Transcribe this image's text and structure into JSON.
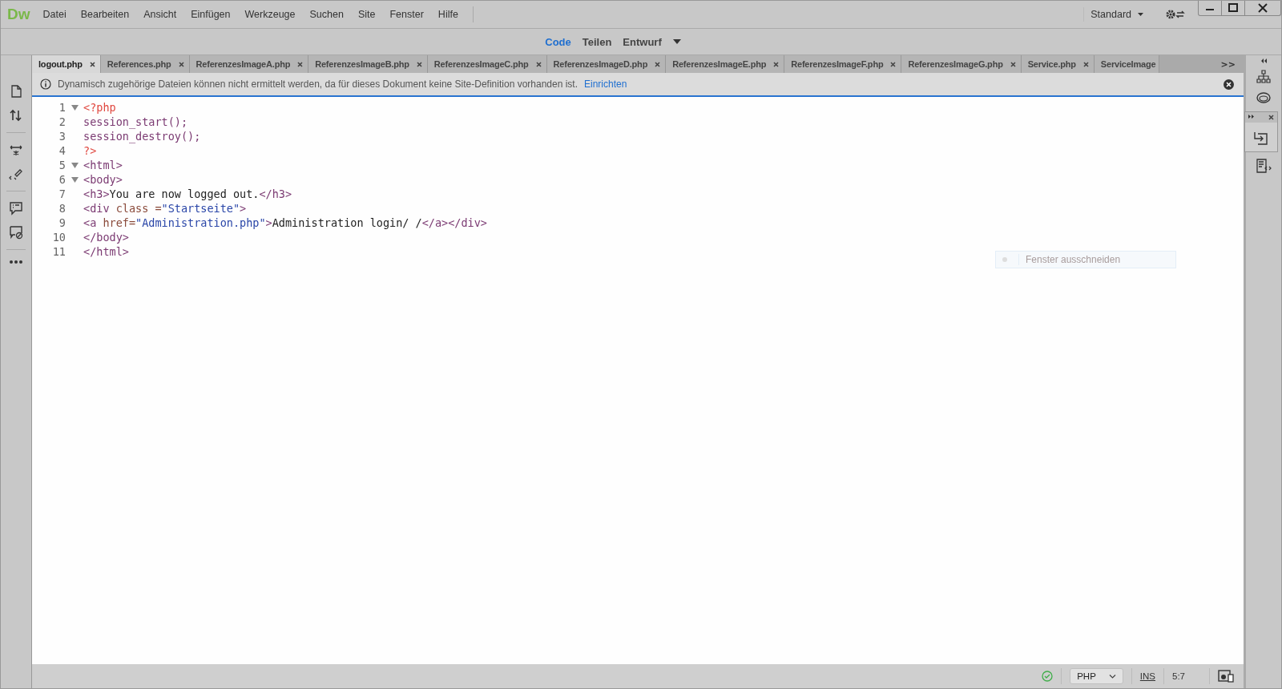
{
  "app": {
    "logo": "Dw"
  },
  "menu": [
    "Datei",
    "Bearbeiten",
    "Ansicht",
    "Einfügen",
    "Werkzeuge",
    "Suchen",
    "Site",
    "Fenster",
    "Hilfe"
  ],
  "workspace": {
    "label": "Standard"
  },
  "views": [
    {
      "label": "Code",
      "selected": true
    },
    {
      "label": "Teilen",
      "selected": false
    },
    {
      "label": "Entwurf",
      "selected": false
    }
  ],
  "tabs": [
    {
      "label": "logout.php",
      "selected": true
    },
    {
      "label": "References.php",
      "selected": false
    },
    {
      "label": "ReferenzesImageA.php",
      "selected": false
    },
    {
      "label": "ReferenzesImageB.php",
      "selected": false
    },
    {
      "label": "ReferenzesImageC.php",
      "selected": false
    },
    {
      "label": "ReferenzesImageD.php",
      "selected": false
    },
    {
      "label": "ReferenzesImageE.php",
      "selected": false
    },
    {
      "label": "ReferenzesImageF.php",
      "selected": false
    },
    {
      "label": "ReferenzesImageG.php",
      "selected": false
    },
    {
      "label": "Service.php",
      "selected": false
    },
    {
      "label": "ServiceImage",
      "selected": false
    }
  ],
  "tab_overflow": ">>",
  "info_bar": {
    "message": "Dynamisch zugehörige Dateien können nicht ermittelt werden, da für dieses Dokument keine Site-Definition vorhanden ist.",
    "link": "Einrichten"
  },
  "code_lines": [
    {
      "number": "1",
      "fold": true,
      "tokens": [
        {
          "text": "<?php",
          "kind": "php"
        }
      ]
    },
    {
      "number": "2",
      "fold": false,
      "tokens": [
        {
          "text": "session_start();",
          "kind": "fn"
        }
      ]
    },
    {
      "number": "3",
      "fold": false,
      "tokens": [
        {
          "text": "session_destroy();",
          "kind": "fn"
        }
      ]
    },
    {
      "number": "4",
      "fold": false,
      "tokens": [
        {
          "text": "?>",
          "kind": "php"
        }
      ]
    },
    {
      "number": "5",
      "fold": true,
      "tokens": [
        {
          "text": "<html>",
          "kind": "tag"
        }
      ]
    },
    {
      "number": "6",
      "fold": true,
      "tokens": [
        {
          "text": "<body>",
          "kind": "tag"
        }
      ]
    },
    {
      "number": "7",
      "fold": false,
      "tokens": [
        {
          "text": "<h3>",
          "kind": "tag"
        },
        {
          "text": "You are now logged out.",
          "kind": "text"
        },
        {
          "text": "</h3>",
          "kind": "tag"
        }
      ]
    },
    {
      "number": "8",
      "fold": false,
      "tokens": [
        {
          "text": "<div ",
          "kind": "tag"
        },
        {
          "text": "class =",
          "kind": "attr"
        },
        {
          "text": "\"Startseite\"",
          "kind": "string"
        },
        {
          "text": ">",
          "kind": "tag"
        }
      ]
    },
    {
      "number": "9",
      "fold": false,
      "tokens": [
        {
          "text": "<a ",
          "kind": "tag"
        },
        {
          "text": "href=",
          "kind": "attr"
        },
        {
          "text": "\"Administration.php\"",
          "kind": "string"
        },
        {
          "text": ">",
          "kind": "tag"
        },
        {
          "text": "Administration login/ /",
          "kind": "text"
        },
        {
          "text": "</a></div>",
          "kind": "tag"
        }
      ]
    },
    {
      "number": "10",
      "fold": false,
      "tokens": [
        {
          "text": "</body>",
          "kind": "tag"
        }
      ]
    },
    {
      "number": "11",
      "fold": false,
      "tokens": [
        {
          "text": "</html>",
          "kind": "tag"
        }
      ]
    }
  ],
  "ghost_hint": {
    "label": "Fenster ausschneiden"
  },
  "status_bar": {
    "language": "PHP",
    "mode": "INS",
    "position": "5:7"
  }
}
